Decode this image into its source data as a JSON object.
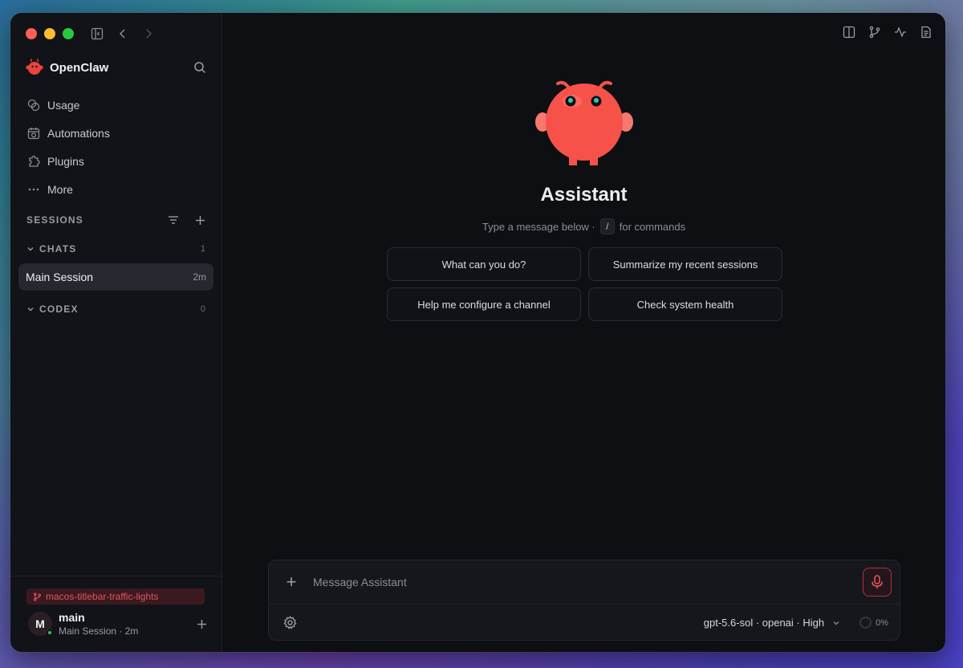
{
  "app": {
    "name": "OpenClaw"
  },
  "colors": {
    "accent": "#f6524a",
    "window_bg": "#0e0f13",
    "sidebar_bg": "#121318",
    "online": "#2fc46a"
  },
  "sidebar": {
    "nav": [
      {
        "label": "Usage",
        "icon": "usage-icon"
      },
      {
        "label": "Automations",
        "icon": "calendar-clock-icon"
      },
      {
        "label": "Plugins",
        "icon": "puzzle-icon"
      },
      {
        "label": "More",
        "icon": "ellipsis-icon"
      }
    ],
    "sessions_label": "SESSIONS",
    "chats": {
      "label": "CHATS",
      "count": "1"
    },
    "session": {
      "name": "Main Session",
      "age": "2m"
    },
    "codex": {
      "label": "CODEX",
      "count": "0"
    },
    "footer": {
      "branch": "macos-titlebar-traffic-lights",
      "avatar_letter": "M",
      "user_name": "main",
      "user_sub": "Main Session · 2m"
    }
  },
  "main": {
    "title": "Assistant",
    "subtitle_before": "Type a message below ·",
    "subtitle_key": "/",
    "subtitle_after": "for commands",
    "suggestions": [
      "What can you do?",
      "Summarize my recent sessions",
      "Help me configure a channel",
      "Check system health"
    ],
    "composer": {
      "placeholder": "Message Assistant",
      "model": "gpt-5.6-sol · openai · High",
      "context": "0%"
    }
  }
}
